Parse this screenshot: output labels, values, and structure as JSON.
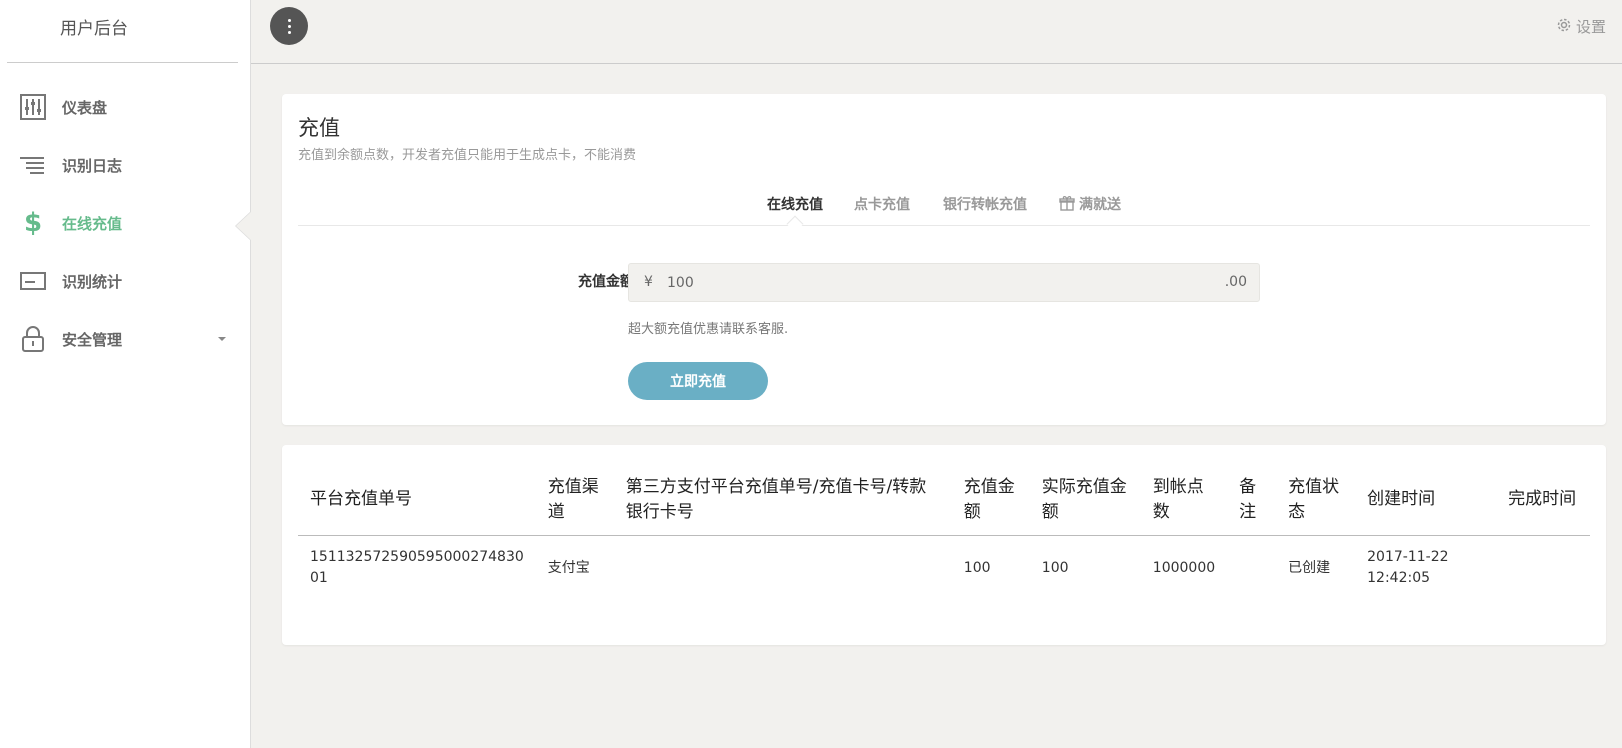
{
  "sidebar": {
    "brand": "用户后台",
    "items": [
      {
        "label": "仪表盘",
        "icon": "sliders-icon"
      },
      {
        "label": "识别日志",
        "icon": "lines-icon"
      },
      {
        "label": "在线充值",
        "icon": "dollar-icon",
        "active": true
      },
      {
        "label": "识别统计",
        "icon": "card-icon"
      },
      {
        "label": "安全管理",
        "icon": "lock-icon",
        "has_submenu": true
      }
    ]
  },
  "topbar": {
    "settings_label": "设置"
  },
  "recharge": {
    "title": "充值",
    "subtitle": "充值到余额点数，开发者充值只能用于生成点卡，不能消费",
    "tabs": [
      {
        "label": "在线充值",
        "active": true
      },
      {
        "label": "点卡充值"
      },
      {
        "label": "银行转帐充值"
      },
      {
        "label": "满就送",
        "icon": "gift-icon"
      }
    ],
    "amount_label": "充值金额",
    "currency_symbol": "¥",
    "amount_value": "100",
    "amount_suffix": ".00",
    "hint": "超大额充值优惠请联系客服.",
    "submit_label": "立即充值"
  },
  "orders": {
    "columns": [
      "平台充值单号",
      "充值渠道",
      "第三方支付平台充值单号/充值卡号/转款银行卡号",
      "充值金额",
      "实际充值金额",
      "到帐点数",
      "备注",
      "充值状态",
      "创建时间",
      "完成时间"
    ],
    "rows": [
      [
        "151132572590595000274830 01",
        "支付宝",
        "",
        "100",
        "100",
        "1000000",
        "",
        "已创建",
        "2017-11-22 12:42:05",
        ""
      ]
    ]
  },
  "colors": {
    "accent_green": "#66bb8c",
    "button_blue": "#6aafc5",
    "page_bg": "#f2f1ee"
  }
}
